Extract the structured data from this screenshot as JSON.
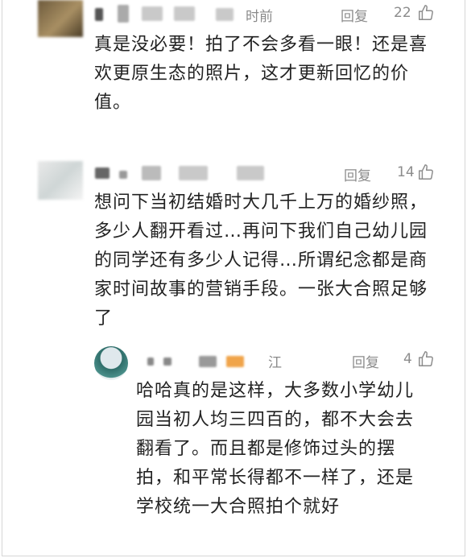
{
  "comments": [
    {
      "name_tail": "时前",
      "reply_label": "回复",
      "like_count": "22",
      "text": "真是没必要！拍了不会多看一眼！还是喜欢更原生态的照片，这才更新回忆的价值。"
    },
    {
      "name_tail": "",
      "reply_label": "回复",
      "like_count": "14",
      "text": "想问下当初结婚时大几千上万的婚纱照，多少人翻开看过…再问下我们自己幼儿园的同学还有多少人记得…所谓纪念都是商家时间故事的营销手段。一张大合照足够了"
    },
    {
      "name_tail": "江",
      "reply_label": "回复",
      "like_count": "4",
      "text": "哈哈真的是这样，大多数小学幼儿园当初人均三四百的，都不大会去翻看了。而且都是修饰过头的摆拍，和平常长得都不一样了，还是学校统一大合照拍个就好"
    }
  ],
  "icons": {
    "like": "thumbs-up-icon"
  },
  "colors": {
    "meta": "#8c8c8c",
    "text": "#222222",
    "accent_blur": "#f0a44a"
  }
}
